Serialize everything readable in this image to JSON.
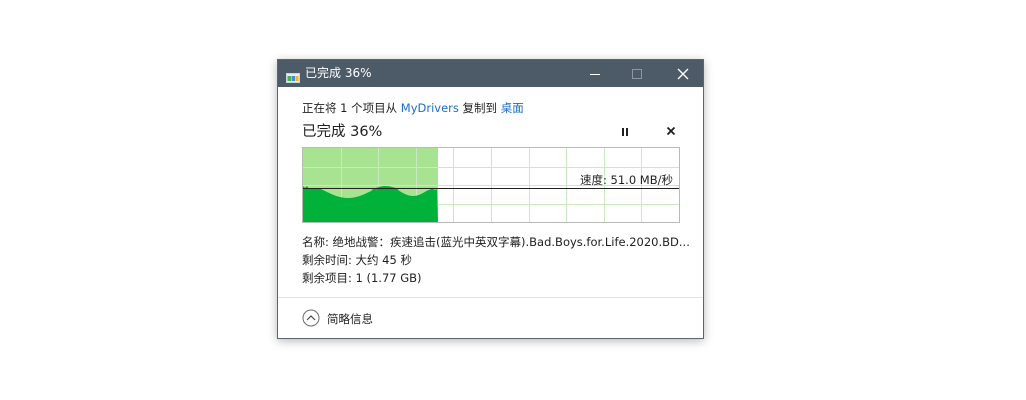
{
  "window": {
    "title": "已完成 36%"
  },
  "copy_status": {
    "prefix": "正在将 1 个项目从 ",
    "source": "MyDrivers",
    "middle": " 复制到 ",
    "destination": "桌面"
  },
  "progress": {
    "label": "已完成 36%",
    "percent": 36
  },
  "speed": {
    "label": "速度: 51.0 MB/秒"
  },
  "info": {
    "name": "名称: 绝地战警：疾速追击(蓝光中英双字幕).Bad.Boys.for.Life.2020.BD...",
    "time_remaining": "剩余时间: 大约 45 秒",
    "items_remaining": "剩余项目: 1 (1.77 GB)"
  },
  "footer": {
    "details_label": "简略信息"
  },
  "icons": {
    "window": "file-copy-icon",
    "minimize": "minimize-icon",
    "maximize": "maximize-icon",
    "close": "close-icon",
    "pause": "pause-icon",
    "cancel": "cancel-icon",
    "details": "chevron-up-circle-icon"
  },
  "colors": {
    "titlebar": "#4d5a68",
    "link": "#1a6fc2",
    "graph_done": "#a8e391",
    "graph_fill": "#00b23a",
    "graph_grid": "#c7eac0"
  }
}
